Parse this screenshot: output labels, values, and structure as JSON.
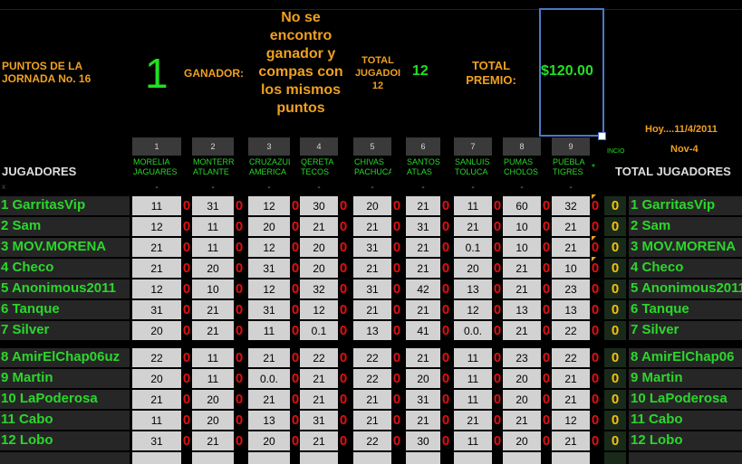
{
  "header": {
    "puntos_label": "PUNTOS DE LA JORNADA No. 16",
    "puntos_value": "1",
    "ganador_label": "GANADOR:",
    "ganador_message": "No se encontro ganador y compas con los mismos puntos",
    "total_jugadores_label": "TOTAL JUGADOI 12",
    "total_jugadores_value": "12",
    "total_premio_label": "TOTAL PREMIO:",
    "total_premio_value": "$120.00",
    "hoy_label": "Hoy....11/4/2011",
    "date_label": "Nov-4",
    "inicio_label": "INCIO",
    "asterisk": "*"
  },
  "left_header": "JUGADORES",
  "left_x": "x",
  "right_header": "TOTAL JUGADORES",
  "matches": [
    {
      "num": "1",
      "home": "MORELIA",
      "away": "JAGUARES"
    },
    {
      "num": "2",
      "home": "MONTERR",
      "away": "ATLANTE"
    },
    {
      "num": "3",
      "home": "CRUZAZUL",
      "away": "AMERICA"
    },
    {
      "num": "4",
      "home": "QERETA",
      "away": "TECOS"
    },
    {
      "num": "5",
      "home": "CHIVAS",
      "away": "PACHUCA"
    },
    {
      "num": "6",
      "home": "SANTOS",
      "away": "ATLAS"
    },
    {
      "num": "7",
      "home": "SANLUIS",
      "away": "TOLUCA"
    },
    {
      "num": "8",
      "home": "PUMAS",
      "away": "CHOLOS"
    },
    {
      "num": "9",
      "home": "PUEBLA",
      "away": "TIGRES"
    }
  ],
  "dash": "-",
  "zero": "0",
  "players": [
    {
      "name": "1 GarritasVip",
      "picks": [
        "11",
        "31",
        "12",
        "30",
        "20",
        "21",
        "11",
        "60",
        "32"
      ],
      "total": "0"
    },
    {
      "name": "2 Sam",
      "picks": [
        "12",
        "11",
        "20",
        "21",
        "21",
        "31",
        "21",
        "10",
        "21"
      ],
      "total": "0"
    },
    {
      "name": "3 MOV.MORENA",
      "picks": [
        "21",
        "11",
        "12",
        "20",
        "31",
        "21",
        "0.1",
        "10",
        "21"
      ],
      "total": "0"
    },
    {
      "name": "4 Checo",
      "picks": [
        "21",
        "20",
        "31",
        "20",
        "21",
        "21",
        "20",
        "21",
        "10"
      ],
      "total": "0"
    },
    {
      "name": "5 Anonimous2011",
      "picks": [
        "12",
        "10",
        "12",
        "32",
        "31",
        "42",
        "13",
        "21",
        "23"
      ],
      "total": "0"
    },
    {
      "name": "6 Tanque",
      "picks": [
        "31",
        "21",
        "31",
        "12",
        "21",
        "21",
        "12",
        "13",
        "13"
      ],
      "total": "0"
    },
    {
      "name": "7 Silver",
      "picks": [
        "20",
        "21",
        "11",
        "0.1",
        "13",
        "41",
        "0.0.",
        "21",
        "22"
      ],
      "total": "0"
    },
    {
      "name": "8 AmirElChap06uz",
      "picks": [
        "22",
        "11",
        "21",
        "22",
        "22",
        "21",
        "11",
        "23",
        "22"
      ],
      "total": "0",
      "right_name": "8 AmirElChap06"
    },
    {
      "name": "9 Martin",
      "picks": [
        "20",
        "11",
        "0.0.",
        "21",
        "22",
        "20",
        "11",
        "20",
        "21"
      ],
      "total": "0"
    },
    {
      "name": "10 LaPoderosa",
      "picks": [
        "21",
        "20",
        "21",
        "21",
        "21",
        "31",
        "11",
        "20",
        "21"
      ],
      "total": "0"
    },
    {
      "name": "11 Cabo",
      "picks": [
        "11",
        "20",
        "13",
        "31",
        "21",
        "21",
        "21",
        "21",
        "12"
      ],
      "total": "0"
    },
    {
      "name": "12 Lobo",
      "picks": [
        "31",
        "21",
        "20",
        "21",
        "22",
        "30",
        "11",
        "20",
        "21"
      ],
      "total": "0"
    }
  ],
  "colors": {
    "green": "#22e022",
    "orange": "#f0a020",
    "red": "#e01010",
    "yellow": "#f2c010",
    "cell": "#d2d2d2",
    "border": "#4a78c8"
  }
}
